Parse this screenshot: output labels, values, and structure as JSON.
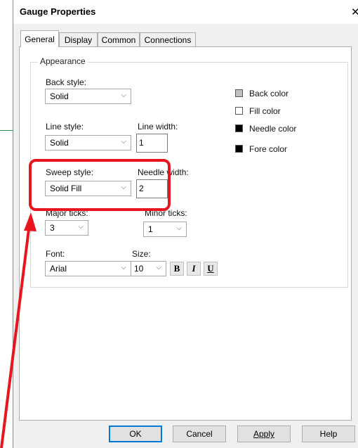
{
  "window": {
    "title": "Gauge Properties",
    "close_glyph": "✕"
  },
  "tabs": [
    {
      "label": "General",
      "active": true
    },
    {
      "label": "Display",
      "active": false
    },
    {
      "label": "Common",
      "active": false
    },
    {
      "label": "Connections",
      "active": false
    }
  ],
  "appearance": {
    "group_label": "Appearance",
    "back_style": {
      "label": "Back style:",
      "value": "Solid"
    },
    "line_style": {
      "label": "Line style:",
      "value": "Solid"
    },
    "line_width": {
      "label": "Line width:",
      "value": "1"
    },
    "sweep_style": {
      "label": "Sweep style:",
      "value": "Solid Fill"
    },
    "needle_width": {
      "label": "Needle width:",
      "value": "2"
    },
    "major_ticks": {
      "label": "Major ticks:",
      "value": "3"
    },
    "minor_ticks": {
      "label": "Minor ticks:",
      "value": "1"
    },
    "font": {
      "label": "Font:",
      "value": "Arial"
    },
    "size": {
      "label": "Size:",
      "value": "10"
    },
    "bold_label": "B",
    "italic_label": "I",
    "underline_label": "U",
    "colors": [
      {
        "label": "Back color",
        "color": "#c0c0c0"
      },
      {
        "label": "Fill color",
        "color": "#ffffff"
      },
      {
        "label": "Needle color",
        "color": "#000000"
      },
      {
        "label": "Fore color",
        "color": "#000000"
      }
    ]
  },
  "buttons": {
    "ok": "OK",
    "cancel": "Cancel",
    "apply": "Apply",
    "help": "Help"
  },
  "annotation": {
    "highlight_color": "#e8151e",
    "arrow_color": "#e8151e"
  }
}
